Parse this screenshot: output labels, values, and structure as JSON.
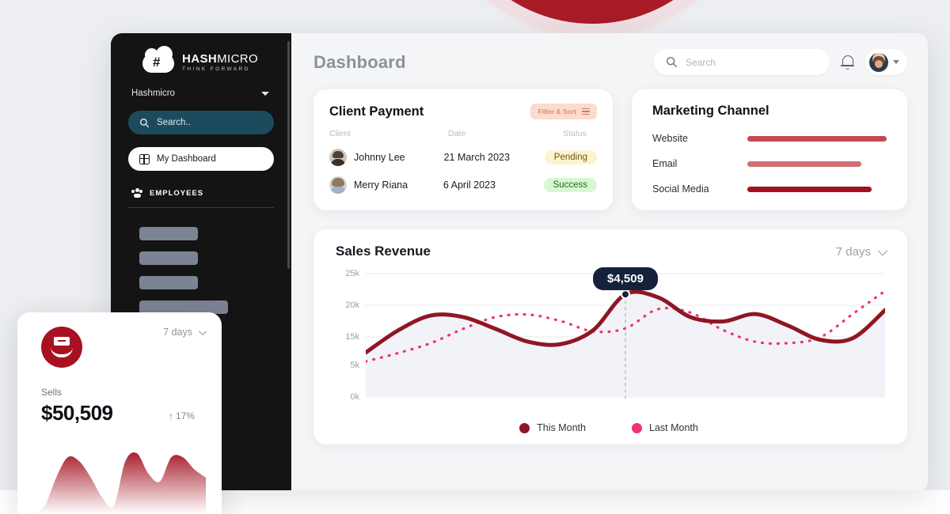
{
  "sidebar": {
    "brand_name_bold": "HASH",
    "brand_name_light": "MICRO",
    "brand_tagline": "THINK FORWARD",
    "org_name": "Hashmicro",
    "search_placeholder": "Search..",
    "nav_item": "My Dashboard",
    "section_label": "EMPLOYEES"
  },
  "header": {
    "title": "Dashboard",
    "search_placeholder": "Search",
    "bell_icon": "bell-icon",
    "avatar_icon": "avatar",
    "chevron_icon": "chevron-down-icon"
  },
  "client_payment": {
    "title": "Client Payment",
    "filter_label": "Filter & Sort",
    "columns": [
      "Client",
      "Date",
      "Status"
    ],
    "rows": [
      {
        "client": "Johnny Lee",
        "date": "21 March 2023",
        "status": "Pending",
        "status_type": "pending"
      },
      {
        "client": "Merry Riana",
        "date": "6 April 2023",
        "status": "Success",
        "status_type": "success"
      }
    ]
  },
  "marketing_channel": {
    "title": "Marketing Channel",
    "colors": {
      "website": "#bf4c52",
      "email": "#cf6e73",
      "social": "#a3101f"
    },
    "rows": [
      {
        "label": "Website",
        "value": 98,
        "color": "#bf4c52"
      },
      {
        "label": "Email",
        "value": 80,
        "color": "#cf6e73"
      },
      {
        "label": "Social Media",
        "value": 87,
        "color": "#a3101f"
      }
    ]
  },
  "sales_revenue": {
    "title": "Sales Revenue",
    "range_label": "7 days",
    "tooltip_value": "$4,509",
    "legend": [
      {
        "label": "This Month",
        "color": "#8f1624"
      },
      {
        "label": "Last Month",
        "color": "#f0346d"
      }
    ]
  },
  "widget": {
    "range_label": "7 days",
    "metric_label": "Sells",
    "value": "$50,509",
    "delta": "17%",
    "delta_arrow": "↑",
    "icon": "sales-handshake-icon"
  },
  "chart_data": {
    "type": "line",
    "title": "Sales Revenue",
    "xlabel": "",
    "ylabel": "",
    "ylim": [
      0,
      25000
    ],
    "ytick_labels": [
      "25k",
      "20k",
      "15k",
      "5k",
      "0k"
    ],
    "ytick_values": [
      25000,
      20000,
      15000,
      5000,
      0
    ],
    "grid": true,
    "legend_position": "bottom-center",
    "annotation": {
      "label": "$4,509",
      "x_index": 8,
      "series": "This Month"
    },
    "x": [
      0,
      1,
      2,
      3,
      4,
      5,
      6,
      7,
      8,
      9,
      10,
      11,
      12,
      13,
      14,
      15,
      16
    ],
    "series": [
      {
        "name": "This Month",
        "color": "#8f1624",
        "style": "solid",
        "values": [
          9000,
          13500,
          16500,
          16200,
          13800,
          11200,
          10700,
          13500,
          20800,
          20200,
          16200,
          15300,
          16800,
          14500,
          11600,
          11900,
          17600
        ]
      },
      {
        "name": "Last Month",
        "color": "#f0346d",
        "style": "dashed",
        "values": [
          7200,
          8900,
          10900,
          13800,
          16200,
          16700,
          15400,
          13300,
          13900,
          17800,
          17100,
          13600,
          11200,
          10900,
          12100,
          16800,
          21500
        ]
      }
    ]
  },
  "widget_chart": {
    "type": "area",
    "color": "#a9202c",
    "values": [
      0,
      2,
      9,
      14,
      13,
      9,
      4,
      2,
      13,
      15,
      10,
      8,
      14,
      14,
      11,
      9
    ]
  }
}
